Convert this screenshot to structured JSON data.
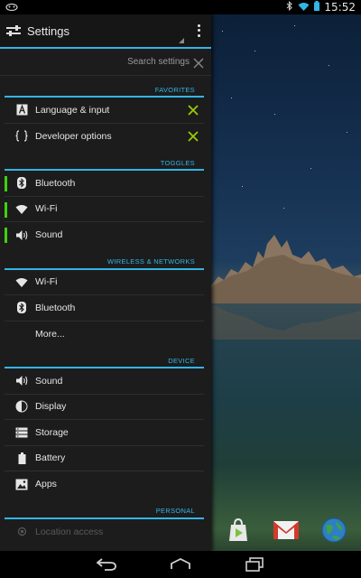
{
  "status_bar": {
    "time": "15:52",
    "icons": [
      "notification-icon",
      "bluetooth-icon",
      "wifi-icon",
      "battery-icon"
    ]
  },
  "settings": {
    "title": "Settings",
    "search_placeholder": "Search settings",
    "sections": {
      "favorites": {
        "header": "FAVORITES",
        "items": [
          {
            "label": "Language & input",
            "icon": "language-icon"
          },
          {
            "label": "Developer options",
            "icon": "developer-icon"
          }
        ]
      },
      "toggles": {
        "header": "TOGGLES",
        "items": [
          {
            "label": "Bluetooth",
            "icon": "bluetooth-icon"
          },
          {
            "label": "Wi-Fi",
            "icon": "wifi-icon"
          },
          {
            "label": "Sound",
            "icon": "sound-icon"
          }
        ]
      },
      "wireless": {
        "header": "WIRELESS & NETWORKS",
        "items": [
          {
            "label": "Wi-Fi",
            "icon": "wifi-icon"
          },
          {
            "label": "Bluetooth",
            "icon": "bluetooth-icon"
          },
          {
            "label": "More..."
          }
        ]
      },
      "device": {
        "header": "DEVICE",
        "items": [
          {
            "label": "Sound",
            "icon": "sound-icon"
          },
          {
            "label": "Display",
            "icon": "display-icon"
          },
          {
            "label": "Storage",
            "icon": "storage-icon"
          },
          {
            "label": "Battery",
            "icon": "battery-icon"
          },
          {
            "label": "Apps",
            "icon": "apps-icon"
          }
        ]
      },
      "personal": {
        "header": "PERSONAL",
        "items": [
          {
            "label": "Location access",
            "icon": "location-icon"
          }
        ]
      }
    }
  },
  "dock": {
    "apps": [
      "play-store-icon",
      "gmail-icon",
      "browser-icon"
    ]
  },
  "colors": {
    "accent": "#33b5e5",
    "toggle_on": "#40d010",
    "favorite_check": "#99cc00"
  }
}
